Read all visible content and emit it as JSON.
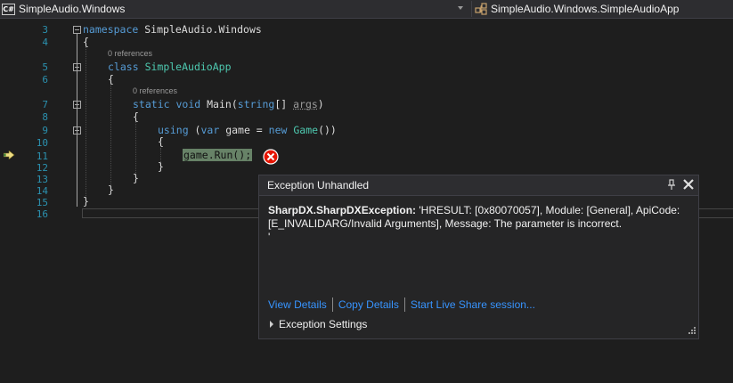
{
  "navbar": {
    "project_icon": "C#",
    "project_scope": "SimpleAudio.Windows",
    "type_scope": "SimpleAudio.Windows.SimpleAudioApp"
  },
  "editor": {
    "line_numbers": [
      "3",
      "4",
      "5",
      "6",
      "7",
      "8",
      "9",
      "10",
      "11",
      "12",
      "13",
      "14",
      "15",
      "16"
    ],
    "code": {
      "l3_kw": "namespace",
      "l3_name": "SimpleAudio.Windows",
      "l4": "{",
      "l5_lens": "0 references",
      "l5_kw": "class",
      "l5_name": "SimpleAudioApp",
      "l6": "{",
      "l7_lens": "0 references",
      "l7_kw1": "static",
      "l7_kw2": "void",
      "l7_method": "Main",
      "l7_open": "(",
      "l7_kw3": "string",
      "l7_brackets": "[] ",
      "l7_param": "args",
      "l7_close": ")",
      "l8": "{",
      "l9_kw1": "using",
      "l9_open": " (",
      "l9_kw2": "var",
      "l9_var": " game = ",
      "l9_kw3": "new",
      "l9_type": "Game",
      "l9_close": "())",
      "l10": "{",
      "l11": "game.Run();",
      "l12": "}",
      "l13": "}",
      "l14": "}",
      "l15": "}"
    }
  },
  "exception": {
    "title": "Exception Unhandled",
    "type": "SharpDX.SharpDXException:",
    "message": " 'HRESULT: [0x80070057], Module: [General], ApiCode: [E_INVALIDARG/Invalid Arguments], Message: The parameter is incorrect.",
    "message_tail": "'",
    "links": {
      "view_details": "View Details",
      "copy_details": "Copy Details",
      "live_share": "Start Live Share session..."
    },
    "settings_label": "Exception Settings"
  },
  "colors": {
    "background": "#1e1e1e",
    "keyword": "#569cd6",
    "type": "#4ec9b0",
    "line_number": "#2b91af",
    "link": "#3794ff",
    "error": "#e51400"
  },
  "icons": [
    "csharp-project-icon",
    "class-icon",
    "instruction-pointer-icon",
    "error-icon",
    "pin-icon",
    "close-icon",
    "resize-grip-icon"
  ]
}
